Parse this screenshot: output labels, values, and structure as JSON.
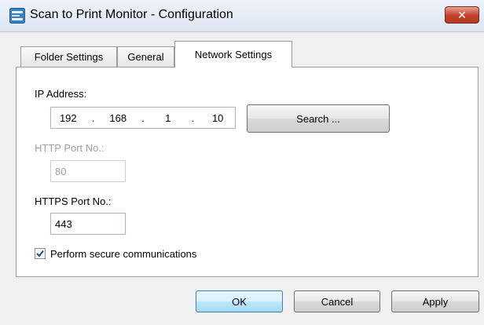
{
  "window": {
    "title": "Scan to Print Monitor - Configuration",
    "close_glyph": "✕"
  },
  "tabs": [
    {
      "label": "Folder Settings",
      "active": false
    },
    {
      "label": "General",
      "active": false
    },
    {
      "label": "Network Settings",
      "active": true
    }
  ],
  "network": {
    "ip_label": "IP Address:",
    "ip": {
      "octet1": "192",
      "octet2": "168",
      "octet3": "1",
      "octet4": "10",
      "dot": "."
    },
    "search_label": "Search ...",
    "http_label": "HTTP Port No.:",
    "http_value": "80",
    "https_label": "HTTPS Port No.:",
    "https_value": "443",
    "secure_label": "Perform secure communications",
    "secure_checked": true
  },
  "buttons": {
    "ok": "OK",
    "cancel": "Cancel",
    "apply": "Apply"
  },
  "colors": {
    "accent": "#3c7fb1",
    "close": "#c2402a"
  }
}
